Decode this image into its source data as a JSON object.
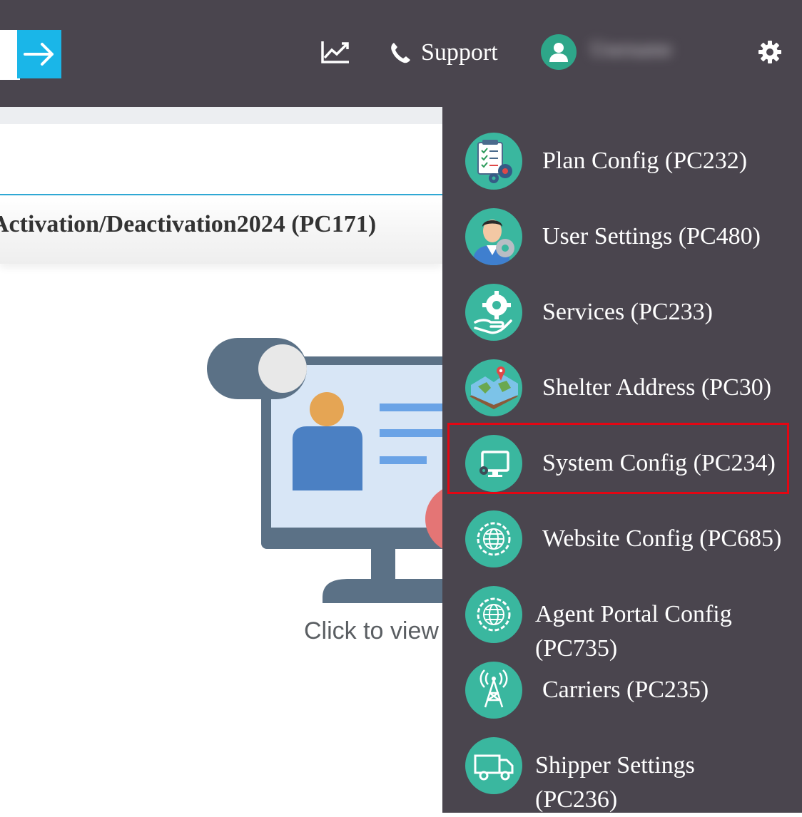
{
  "header": {
    "support_label": "Support",
    "username": "Username"
  },
  "content": {
    "title": "Activation/Deactivation2024 (PC171)",
    "click_text": "Click to view"
  },
  "menu": {
    "items": [
      {
        "label": "Plan Config (PC232)",
        "icon": "plan-config-icon"
      },
      {
        "label": "User Settings (PC480)",
        "icon": "user-settings-icon"
      },
      {
        "label": "Services (PC233)",
        "icon": "services-icon"
      },
      {
        "label": "Shelter Address (PC30)",
        "icon": "shelter-address-icon"
      },
      {
        "label": "System Config (PC234)",
        "icon": "system-config-icon",
        "highlighted": true
      },
      {
        "label": "Website Config (PC685)",
        "icon": "website-config-icon"
      },
      {
        "label": "Agent Portal Config (PC735)",
        "icon": "agent-portal-config-icon"
      },
      {
        "label": "Carriers (PC235)",
        "icon": "carriers-icon"
      },
      {
        "label": "Shipper Settings (PC236)",
        "icon": "shipper-settings-icon"
      }
    ]
  },
  "colors": {
    "topbar": "#4a454e",
    "accent_blue": "#1ab6e8",
    "icon_teal": "#3ab79f",
    "highlight_red": "#e30613"
  }
}
